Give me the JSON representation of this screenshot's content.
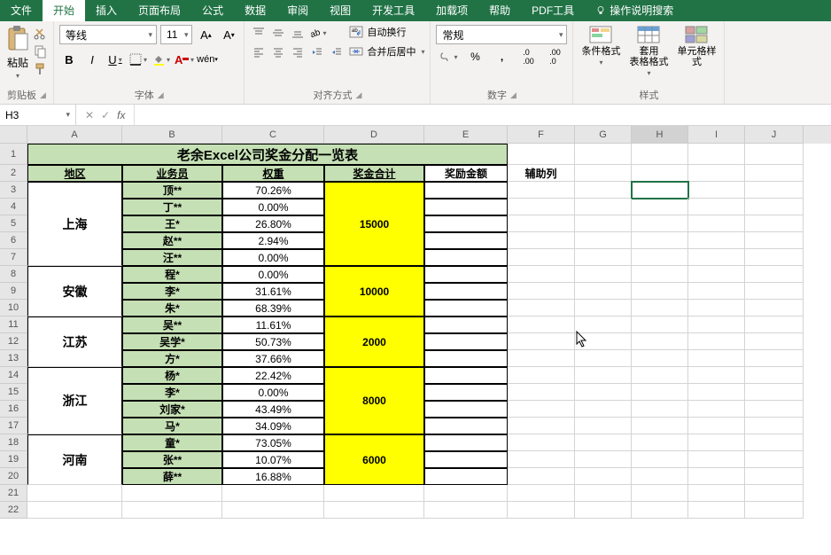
{
  "tabs": {
    "file": "文件",
    "home": "开始",
    "insert": "插入",
    "layout": "页面布局",
    "formula": "公式",
    "data": "数据",
    "review": "审阅",
    "view": "视图",
    "dev": "开发工具",
    "addin": "加载项",
    "help": "帮助",
    "pdf": "PDF工具",
    "tell": "操作说明搜索"
  },
  "ribbon": {
    "clipboard": {
      "paste": "粘贴",
      "label": "剪贴板"
    },
    "font": {
      "name": "等线",
      "size": "11",
      "label": "字体",
      "bold": "B",
      "italic": "I",
      "underline": "U"
    },
    "align": {
      "label": "对齐方式",
      "wrap": "自动换行",
      "merge": "合并后居中"
    },
    "number": {
      "format": "常规",
      "label": "数字"
    },
    "styles": {
      "cond": "条件格式",
      "table": "套用\n表格格式",
      "cell": "单元格样式",
      "label": "样式"
    }
  },
  "fx": {
    "nameBox": "H3",
    "value": ""
  },
  "colHeaders": [
    "A",
    "B",
    "C",
    "D",
    "E",
    "F",
    "G",
    "H",
    "I",
    "J"
  ],
  "rowCount": 22,
  "sheet": {
    "title": "老余Excel公司奖金分配一览表",
    "headers": {
      "region": "地区",
      "agent": "业务员",
      "weight": "权重",
      "bonusTotal": "奖金合计",
      "award": "奖励金额",
      "aux": "辅助列"
    },
    "regions": [
      {
        "name": "上海",
        "bonus": "15000",
        "rows": [
          {
            "n": "顶**",
            "w": "70.26%"
          },
          {
            "n": "丁**",
            "w": "0.00%"
          },
          {
            "n": "王*",
            "w": "26.80%"
          },
          {
            "n": "赵**",
            "w": "2.94%"
          },
          {
            "n": "汪**",
            "w": "0.00%"
          }
        ]
      },
      {
        "name": "安徽",
        "bonus": "10000",
        "rows": [
          {
            "n": "程*",
            "w": "0.00%"
          },
          {
            "n": "李*",
            "w": "31.61%"
          },
          {
            "n": "朱*",
            "w": "68.39%"
          }
        ]
      },
      {
        "name": "江苏",
        "bonus": "2000",
        "rows": [
          {
            "n": "吴**",
            "w": "11.61%"
          },
          {
            "n": "吴学*",
            "w": "50.73%"
          },
          {
            "n": "方*",
            "w": "37.66%"
          }
        ]
      },
      {
        "name": "浙江",
        "bonus": "8000",
        "rows": [
          {
            "n": "杨*",
            "w": "22.42%"
          },
          {
            "n": "李*",
            "w": "0.00%"
          },
          {
            "n": "刘家*",
            "w": "43.49%"
          },
          {
            "n": "马*",
            "w": "34.09%"
          }
        ]
      },
      {
        "name": "河南",
        "bonus": "6000",
        "rows": [
          {
            "n": "童*",
            "w": "73.05%"
          },
          {
            "n": "张**",
            "w": "10.07%"
          },
          {
            "n": "薛**",
            "w": "16.88%"
          }
        ]
      }
    ]
  }
}
